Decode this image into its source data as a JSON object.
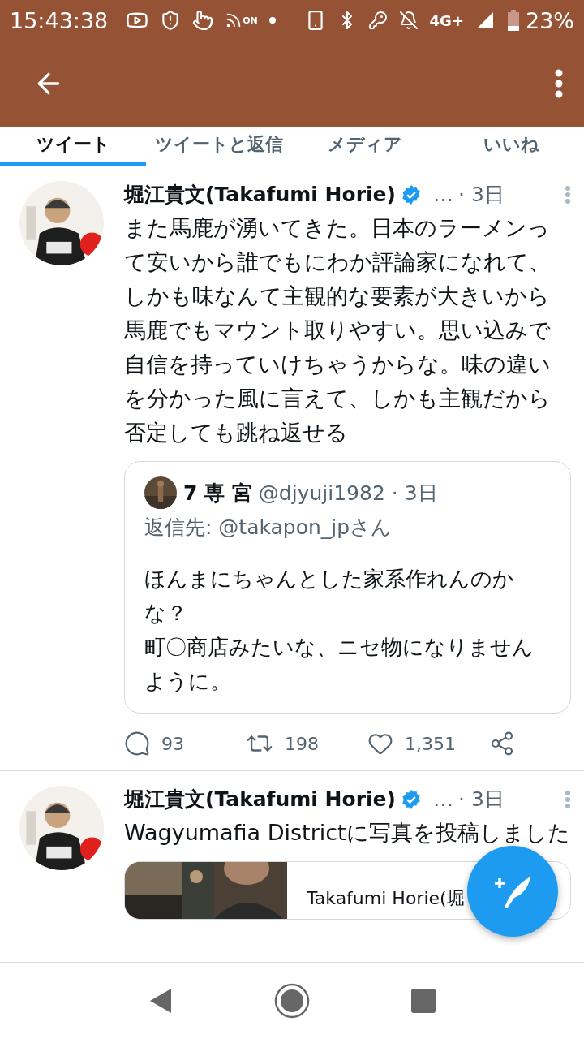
{
  "status_bar": {
    "time": "15:43:38",
    "on_label": "ON",
    "network": "4G+",
    "battery": "23%"
  },
  "tabs": [
    {
      "label": "ツイート",
      "selected": true
    },
    {
      "label": "ツイートと返信",
      "selected": false
    },
    {
      "label": "メディア",
      "selected": false
    },
    {
      "label": "いいね",
      "selected": false
    }
  ],
  "tweets": [
    {
      "kind": "quote",
      "author": "堀江貴文(Takafumi Horie)",
      "verified": true,
      "ellipsis": "…",
      "time": "· 3日",
      "text": "また馬鹿が湧いてきた。日本のラーメンって安いから誰でもにわか評論家になれて、しかも味なんて主観的な要素が大きいから馬鹿でもマウント取りやすい。思い込みで自信を持っていけちゃうからな。味の違いを分かった風に言えて、しかも主観だから否定しても跳ね返せる",
      "quote": {
        "name": "7 専 宮",
        "handle": "@djyuji1982",
        "time": "· 3日",
        "reply_to": "返信先: @takapon_jpさん",
        "lines": [
          "ほんまにちゃんとした家系作れんのかな？",
          "町〇商店みたいな、ニセ物になりませんように。"
        ]
      },
      "actions": {
        "replies": "93",
        "retweets": "198",
        "likes": "1,351"
      }
    },
    {
      "kind": "card",
      "author": "堀江貴文(Takafumi Horie)",
      "verified": true,
      "ellipsis": "…",
      "time": "· 3日",
      "text": "Wagyumafia Districtに写真を投稿しました",
      "card": {
        "title": "Takafumi Horie(堀"
      }
    }
  ]
}
